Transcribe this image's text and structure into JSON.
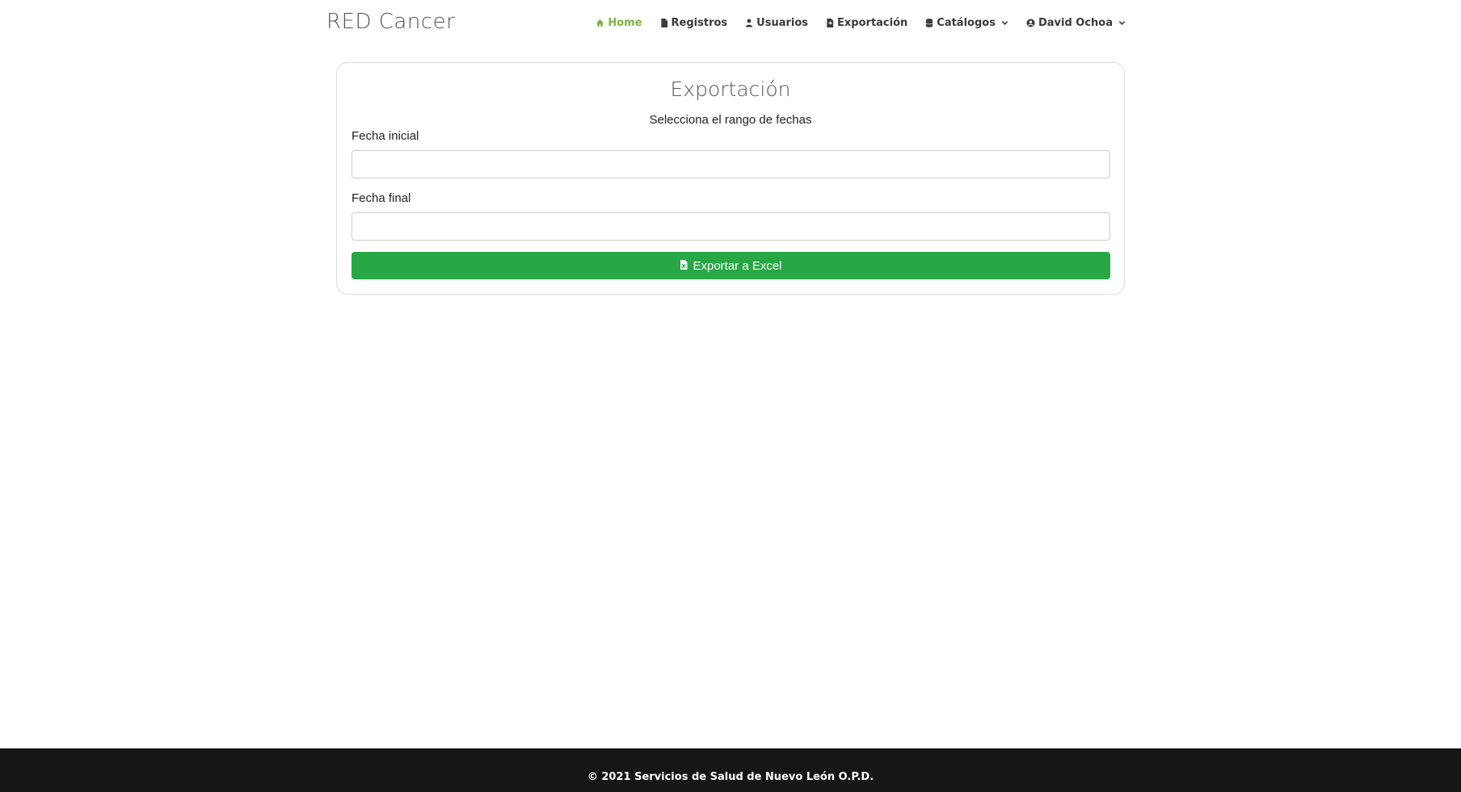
{
  "brand": "RED Cancer",
  "nav": {
    "home": "Home",
    "registros": "Registros",
    "usuarios": "Usuarios",
    "exportacion": "Exportación",
    "catalogos": "Catálogos",
    "user": "David Ochoa"
  },
  "colors": {
    "active": "#7cb342",
    "button": "#28a745",
    "footer": "#161714"
  },
  "card": {
    "title": "Exportación",
    "subtitle": "Selecciona el rango de fechas",
    "start_label": "Fecha inicial",
    "start_value": "",
    "end_label": "Fecha final",
    "end_value": "",
    "button": "Exportar a Excel"
  },
  "footer": "© 2021 Servicios de Salud de Nuevo León O.P.D."
}
